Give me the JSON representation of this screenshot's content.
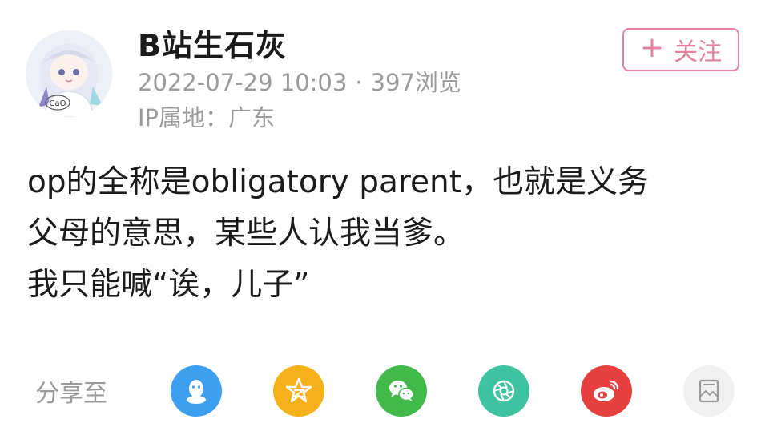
{
  "author": {
    "name": "B站生石灰",
    "date": "2022-07-29 10:03",
    "separator": "·",
    "views": "397浏览",
    "ip_location": "IP属地：广东",
    "avatar_shirt_text": "CaO"
  },
  "follow_button": {
    "plus": "+",
    "label": "关注"
  },
  "post": {
    "lines": [
      "op的全称是obligatory parent，也就是义务",
      "父母的意思，某些人认我当爹。",
      "我只能喊“诶，儿子”"
    ]
  },
  "share": {
    "label": "分享至",
    "targets": [
      "qq-icon",
      "qzone-icon",
      "wechat-icon",
      "moments-icon",
      "weibo-icon",
      "poster-icon"
    ]
  },
  "colors": {
    "accent_pink": "#e3819e",
    "meta_gray": "#9b9b9b",
    "qq_blue": "#3d9ff0",
    "qzone_yellow": "#f5b11c",
    "wechat_green": "#42b94a",
    "moments_teal": "#3fc2a0",
    "weibo_red": "#e54040"
  }
}
